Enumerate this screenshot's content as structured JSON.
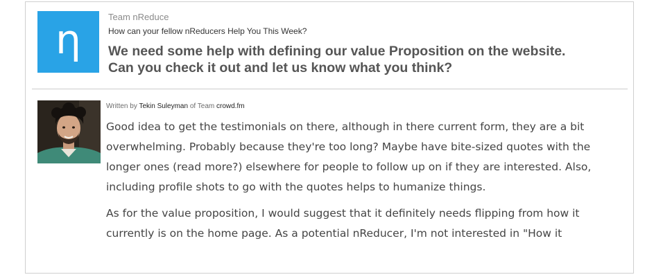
{
  "post": {
    "logo_letter": "η",
    "team_name": "Team nReduce",
    "question": "How can your fellow nReducers Help You This Week?",
    "request_line1": "We need some help with defining our value Proposition on the website.",
    "request_line2": "Can you check it out and let us know what you think?"
  },
  "reply": {
    "written_by_label": "Written by",
    "author_name": "Tekin Suleyman",
    "of_team_label": "of Team",
    "author_team": "crowd.fm",
    "paragraph1": "Good idea to get the testimonials on there, although in there current form, they are a bit overwhelming. Probably because they're too long? Maybe have bite-sized quotes with the longer ones (read more?) elsewhere for people to follow up on if they are interested. Also, including profile shots to go with the quotes helps to humanize things.",
    "paragraph2": "As for the value proposition, I would suggest that it definitely needs flipping from how it currently is on the home page. As a potential nReducer, I'm not interested in \"How it"
  },
  "colors": {
    "logo_blue": "#29a3e6",
    "border": "#cfcfcf",
    "body_text": "#444444",
    "heading_text": "#555555"
  }
}
